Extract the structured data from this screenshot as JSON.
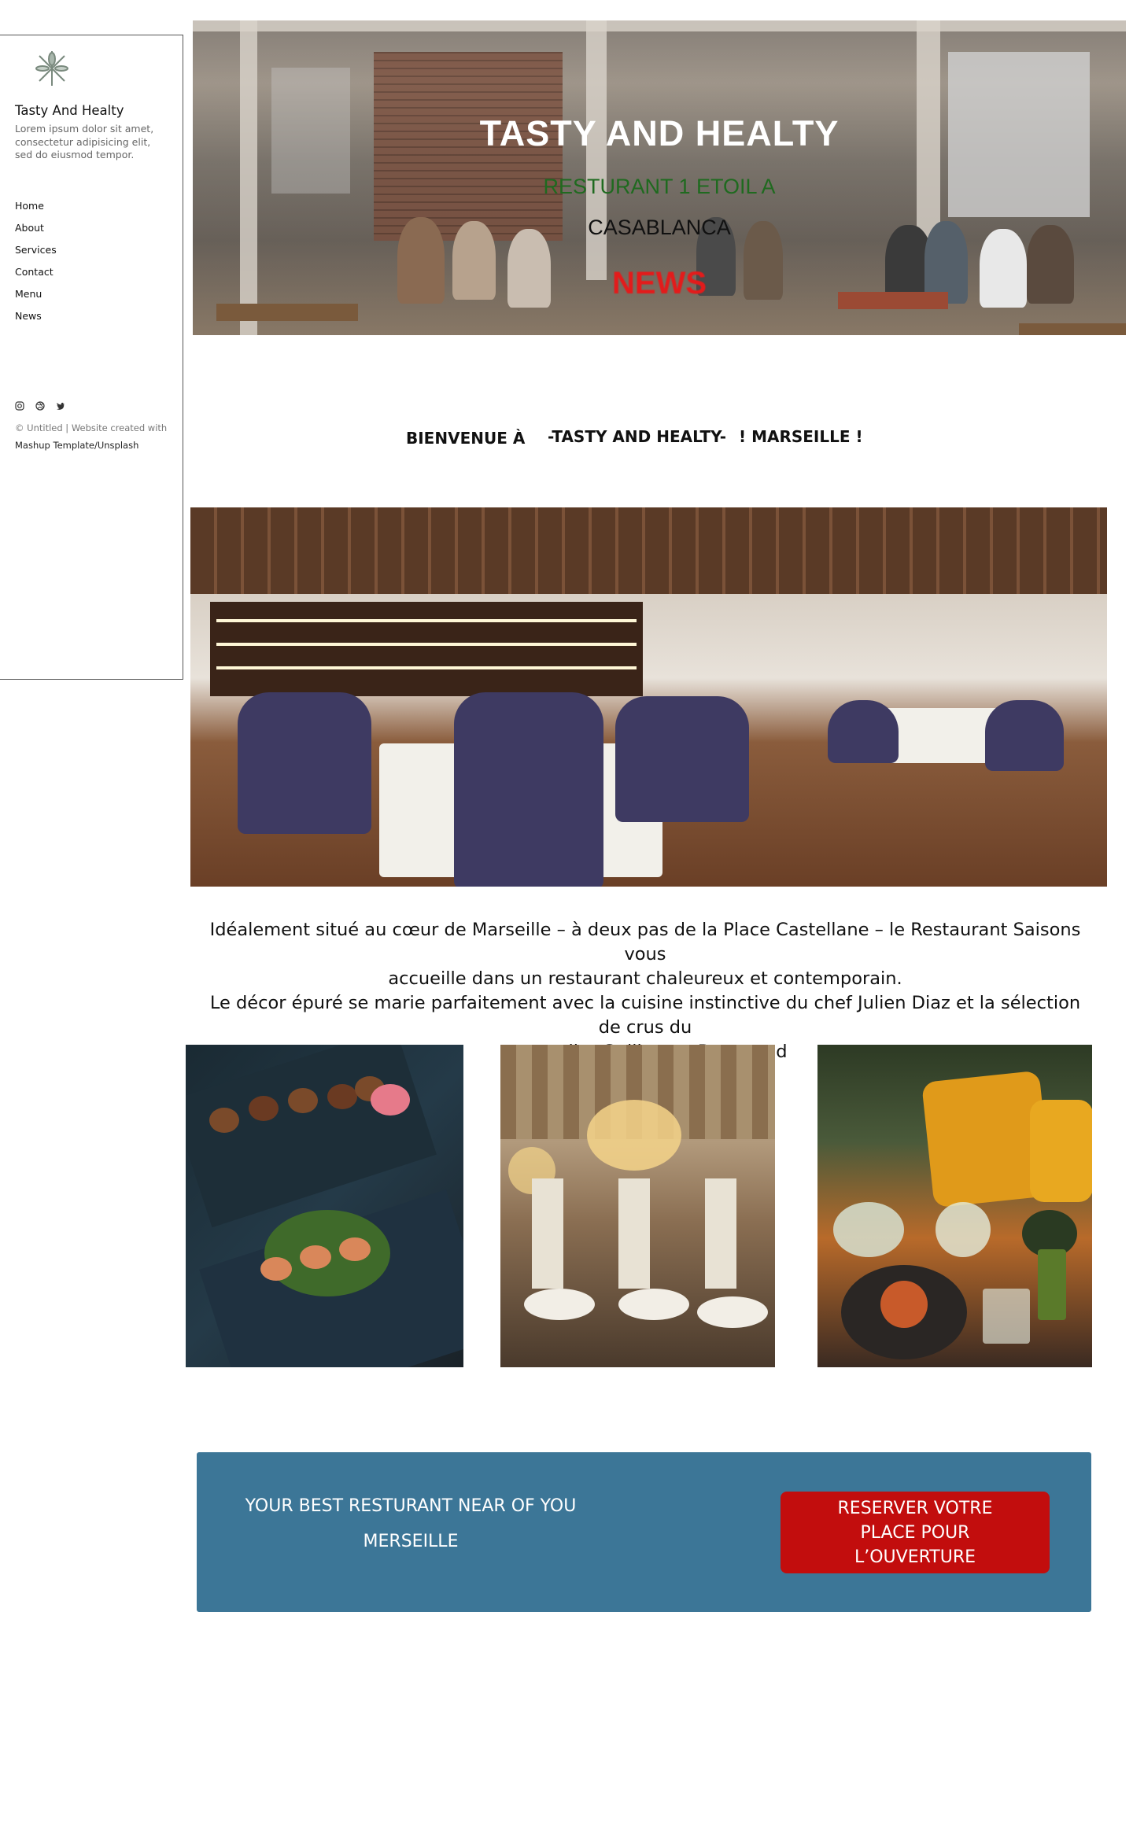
{
  "sidebar": {
    "brand": "Tasty And Healty",
    "tagline": "Lorem ipsum dolor sit amet, consectetur adipisicing elit, sed do eiusmod tempor.",
    "nav": [
      "Home",
      "About",
      "Services",
      "Contact",
      "Menu",
      "News"
    ],
    "social_icons": [
      "instagram-icon",
      "dribbble-icon",
      "twitter-icon"
    ],
    "copyright_line1": "© Untitled | Website created with",
    "copyright_line2": "Mashup Template/Unsplash"
  },
  "hero": {
    "title": "TASTY AND HEALTY",
    "subtitle1": "RESTURANT 1 ETOIL A",
    "subtitle2": "CASABLANCA",
    "news": "NEWS"
  },
  "welcome": {
    "part1": "BIENVENUE À",
    "part2": "-TASTY AND HEALTY-",
    "part3": "! MARSEILLE !"
  },
  "about": {
    "line1": "Idéalement situé au cœur de Marseille – à deux pas de la Place Castellane – le Restaurant Saisons vous",
    "line2": "accueille dans un restaurant chaleureux et contemporain.",
    "line3": "Le décor épuré se marie parfaitement avec la cuisine instinctive du chef Julien Diaz et la sélection de crus du",
    "line4": "sommelier Guillaume Bonneaud"
  },
  "cta": {
    "line1": "YOUR BEST RESTURANT NEAR OF YOU",
    "line2": "MERSEILLE",
    "button": "RESERVER VOTRE PLACE POUR L’OUVERTURE"
  },
  "colors": {
    "cta_background": "#3c7697",
    "cta_button": "#c20d0d",
    "hero_sub1": "#1f6a1f",
    "hero_news": "#e31b1b"
  }
}
